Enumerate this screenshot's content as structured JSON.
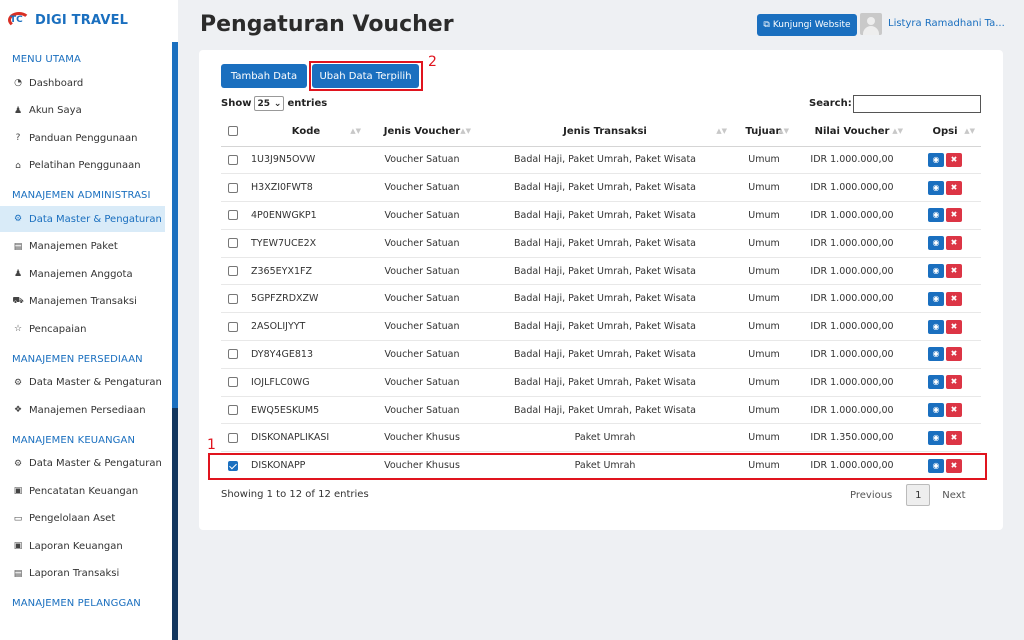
{
  "brand": {
    "logo_text": "TC",
    "name": "DIGI TRAVEL"
  },
  "sidebar": {
    "sections": [
      {
        "title": "MENU UTAMA",
        "items": [
          {
            "label": "Dashboard",
            "icon": "dashboard-icon",
            "glyph": "◔"
          },
          {
            "label": "Akun Saya",
            "icon": "user-icon",
            "glyph": "♟"
          },
          {
            "label": "Panduan Penggunaan",
            "icon": "question-icon",
            "glyph": "?"
          },
          {
            "label": "Pelatihan Penggunaan",
            "icon": "graduation-cap-icon",
            "glyph": "⌂"
          }
        ]
      },
      {
        "title": "MANAJEMEN ADMINISTRASI",
        "items": [
          {
            "label": "Data Master & Pengaturan",
            "icon": "cogs-icon",
            "glyph": "⚙",
            "active": true
          },
          {
            "label": "Manajemen Paket",
            "icon": "book-icon",
            "glyph": "▤"
          },
          {
            "label": "Manajemen Anggota",
            "icon": "users-icon",
            "glyph": "♟"
          },
          {
            "label": "Manajemen Transaksi",
            "icon": "cart-icon",
            "glyph": "⛟"
          },
          {
            "label": "Pencapaian",
            "icon": "star-icon",
            "glyph": "☆"
          }
        ]
      },
      {
        "title": "MANAJEMEN PERSEDIAAN",
        "items": [
          {
            "label": "Data Master & Pengaturan",
            "icon": "cogs-icon",
            "glyph": "⚙"
          },
          {
            "label": "Manajemen Persediaan",
            "icon": "boxes-icon",
            "glyph": "❖"
          }
        ]
      },
      {
        "title": "MANAJEMEN KEUANGAN",
        "items": [
          {
            "label": "Data Master & Pengaturan",
            "icon": "cogs-icon",
            "glyph": "⚙"
          },
          {
            "label": "Pencatatan Keuangan",
            "icon": "money-icon",
            "glyph": "▣"
          },
          {
            "label": "Pengelolaan Aset",
            "icon": "hdd-icon",
            "glyph": "▭"
          },
          {
            "label": "Laporan Keuangan",
            "icon": "money-icon",
            "glyph": "▣"
          },
          {
            "label": "Laporan Transaksi",
            "icon": "book-icon",
            "glyph": "▤"
          }
        ]
      },
      {
        "title": "MANAJEMEN PELANGGAN",
        "items": []
      }
    ]
  },
  "header": {
    "title": "Pengaturan Voucher",
    "visit_label": "Kunjungi Website",
    "visit_icon": "external-link-icon",
    "user_name": "Listyra Ramadhani Ta..."
  },
  "toolbar": {
    "add_label": "Tambah Data",
    "edit_label": "Ubah Data Terpilih"
  },
  "table_controls": {
    "show_label": "Show",
    "entries_value": "25",
    "entries_label": "entries",
    "search_label": "Search:",
    "search_value": ""
  },
  "table": {
    "columns": [
      "Kode",
      "Jenis Voucher",
      "Jenis Transaksi",
      "Tujuan",
      "Nilai Voucher",
      "Opsi"
    ],
    "rows": [
      {
        "checked": false,
        "code": "1U3J9N5OVW",
        "type": "Voucher Satuan",
        "trans": "Badal Haji, Paket Umrah, Paket Wisata",
        "target": "Umum",
        "value": "IDR 1.000.000,00"
      },
      {
        "checked": false,
        "code": "H3XZI0FWT8",
        "type": "Voucher Satuan",
        "trans": "Badal Haji, Paket Umrah, Paket Wisata",
        "target": "Umum",
        "value": "IDR 1.000.000,00"
      },
      {
        "checked": false,
        "code": "4P0ENWGKP1",
        "type": "Voucher Satuan",
        "trans": "Badal Haji, Paket Umrah, Paket Wisata",
        "target": "Umum",
        "value": "IDR 1.000.000,00"
      },
      {
        "checked": false,
        "code": "TYEW7UCE2X",
        "type": "Voucher Satuan",
        "trans": "Badal Haji, Paket Umrah, Paket Wisata",
        "target": "Umum",
        "value": "IDR 1.000.000,00"
      },
      {
        "checked": false,
        "code": "Z365EYX1FZ",
        "type": "Voucher Satuan",
        "trans": "Badal Haji, Paket Umrah, Paket Wisata",
        "target": "Umum",
        "value": "IDR 1.000.000,00"
      },
      {
        "checked": false,
        "code": "5GPFZRDXZW",
        "type": "Voucher Satuan",
        "trans": "Badal Haji, Paket Umrah, Paket Wisata",
        "target": "Umum",
        "value": "IDR 1.000.000,00"
      },
      {
        "checked": false,
        "code": "2ASOLIJYYT",
        "type": "Voucher Satuan",
        "trans": "Badal Haji, Paket Umrah, Paket Wisata",
        "target": "Umum",
        "value": "IDR 1.000.000,00"
      },
      {
        "checked": false,
        "code": "DY8Y4GE813",
        "type": "Voucher Satuan",
        "trans": "Badal Haji, Paket Umrah, Paket Wisata",
        "target": "Umum",
        "value": "IDR 1.000.000,00"
      },
      {
        "checked": false,
        "code": "IOJLFLC0WG",
        "type": "Voucher Satuan",
        "trans": "Badal Haji, Paket Umrah, Paket Wisata",
        "target": "Umum",
        "value": "IDR 1.000.000,00"
      },
      {
        "checked": false,
        "code": "EWQ5ESKUM5",
        "type": "Voucher Satuan",
        "trans": "Badal Haji, Paket Umrah, Paket Wisata",
        "target": "Umum",
        "value": "IDR 1.000.000,00"
      },
      {
        "checked": false,
        "code": "DISKONAPLIKASI",
        "type": "Voucher Khusus",
        "trans": "Paket Umrah",
        "target": "Umum",
        "value": "IDR 1.350.000,00"
      },
      {
        "checked": true,
        "code": "DISKONAPP",
        "type": "Voucher Khusus",
        "trans": "Paket Umrah",
        "target": "Umum",
        "value": "IDR 1.000.000,00"
      }
    ]
  },
  "footer": {
    "info": "Showing 1 to 12 of 12 entries",
    "prev_label": "Previous",
    "page": "1",
    "next_label": "Next"
  },
  "annotations": {
    "row_marker": "1",
    "button_marker": "2"
  },
  "colors": {
    "accent": "#1a6fbf",
    "danger": "#dc3545",
    "highlight": "#e0141e",
    "active_bg": "#d9ebf8"
  }
}
